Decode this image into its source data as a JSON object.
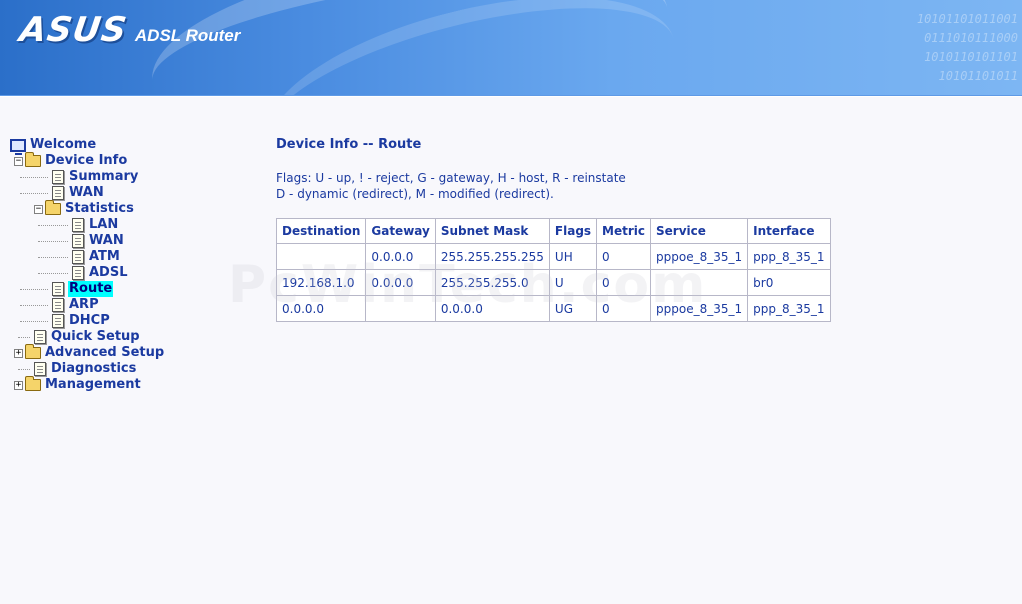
{
  "banner": {
    "logo": "ASUS",
    "product": "ADSL Router",
    "binary_lines": [
      "10101101011001",
      "0111010111000",
      "1010110101101",
      "10101101011"
    ]
  },
  "tree": {
    "welcome": "Welcome",
    "device_info": "Device Info",
    "summary": "Summary",
    "wan": "WAN",
    "statistics": "Statistics",
    "stats_lan": "LAN",
    "stats_wan": "WAN",
    "stats_atm": "ATM",
    "stats_adsl": "ADSL",
    "route": "Route",
    "arp": "ARP",
    "dhcp": "DHCP",
    "quick_setup": "Quick Setup",
    "advanced_setup": "Advanced Setup",
    "diagnostics": "Diagnostics",
    "management": "Management"
  },
  "main": {
    "title": "Device Info -- Route",
    "flags_line1": "Flags: U - up, ! - reject, G - gateway, H - host, R - reinstate",
    "flags_line2": "D - dynamic (redirect), M - modified (redirect).",
    "columns": [
      "Destination",
      "Gateway",
      "Subnet Mask",
      "Flags",
      "Metric",
      "Service",
      "Interface"
    ],
    "rows": [
      [
        "",
        "0.0.0.0",
        "255.255.255.255",
        "UH",
        "0",
        "pppoe_8_35_1",
        "ppp_8_35_1"
      ],
      [
        "192.168.1.0",
        "0.0.0.0",
        "255.255.255.0",
        "U",
        "0",
        "",
        "br0"
      ],
      [
        "0.0.0.0",
        "",
        "0.0.0.0",
        "UG",
        "0",
        "pppoe_8_35_1",
        "ppp_8_35_1"
      ]
    ]
  },
  "watermark": "PcWinTech.com"
}
